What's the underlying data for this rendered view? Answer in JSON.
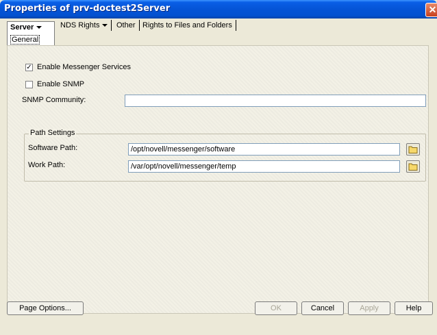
{
  "window": {
    "title": "Properties of prv-doctest2Server"
  },
  "tabs": {
    "active": {
      "label": "Server",
      "sublabel": "General"
    },
    "others": [
      {
        "label": "NDS Rights"
      },
      {
        "label": "Other"
      },
      {
        "label": "Rights to Files and Folders"
      }
    ]
  },
  "form": {
    "enable_messenger": {
      "label": "Enable Messenger Services",
      "checked": true
    },
    "enable_snmp": {
      "label": "Enable SNMP",
      "checked": false
    },
    "snmp_community": {
      "label": "SNMP Community:",
      "value": ""
    },
    "path_settings": {
      "title": "Path Settings",
      "software_path": {
        "label": "Software Path:",
        "value": "/opt/novell/messenger/software"
      },
      "work_path": {
        "label": "Work Path:",
        "value": "/var/opt/novell/messenger/temp"
      }
    }
  },
  "buttons": {
    "page_options": "Page Options...",
    "ok": "OK",
    "cancel": "Cancel",
    "apply": "Apply",
    "help": "Help"
  },
  "colors": {
    "titlebar": "#0554d6",
    "window_bg": "#ece9d8"
  }
}
